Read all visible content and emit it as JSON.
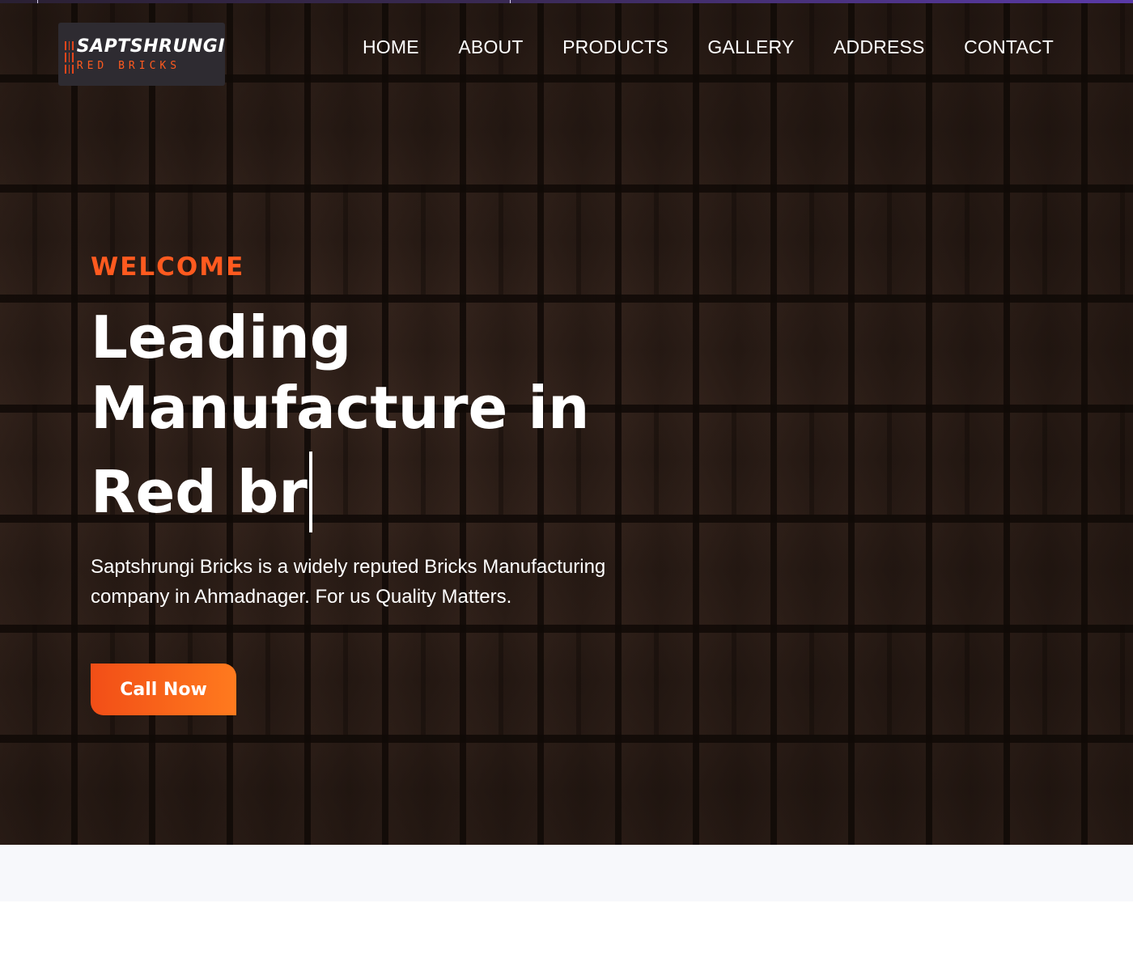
{
  "brand": {
    "name": "SAPTSHRUNGI",
    "tagline": "RED BRICKS",
    "accent_color": "#ff5a1f",
    "icon": "brick-logo-icon"
  },
  "nav": {
    "items": [
      {
        "label": "HOME"
      },
      {
        "label": "ABOUT"
      },
      {
        "label": "PRODUCTS"
      },
      {
        "label": "GALLERY"
      },
      {
        "label": "ADDRESS"
      },
      {
        "label": "CONTACT"
      }
    ]
  },
  "hero": {
    "eyebrow": "WELCOME",
    "headline_line1": "Leading",
    "headline_line2": "Manufacture in",
    "headline_typed": "Red br",
    "description": "Saptshrungi Bricks is a widely reputed Bricks Manufacturing company in Ahmadnager. For us Quality Matters.",
    "cta_label": "Call Now",
    "cta_gradient": [
      "#f24e17",
      "#ff7a1e"
    ]
  }
}
